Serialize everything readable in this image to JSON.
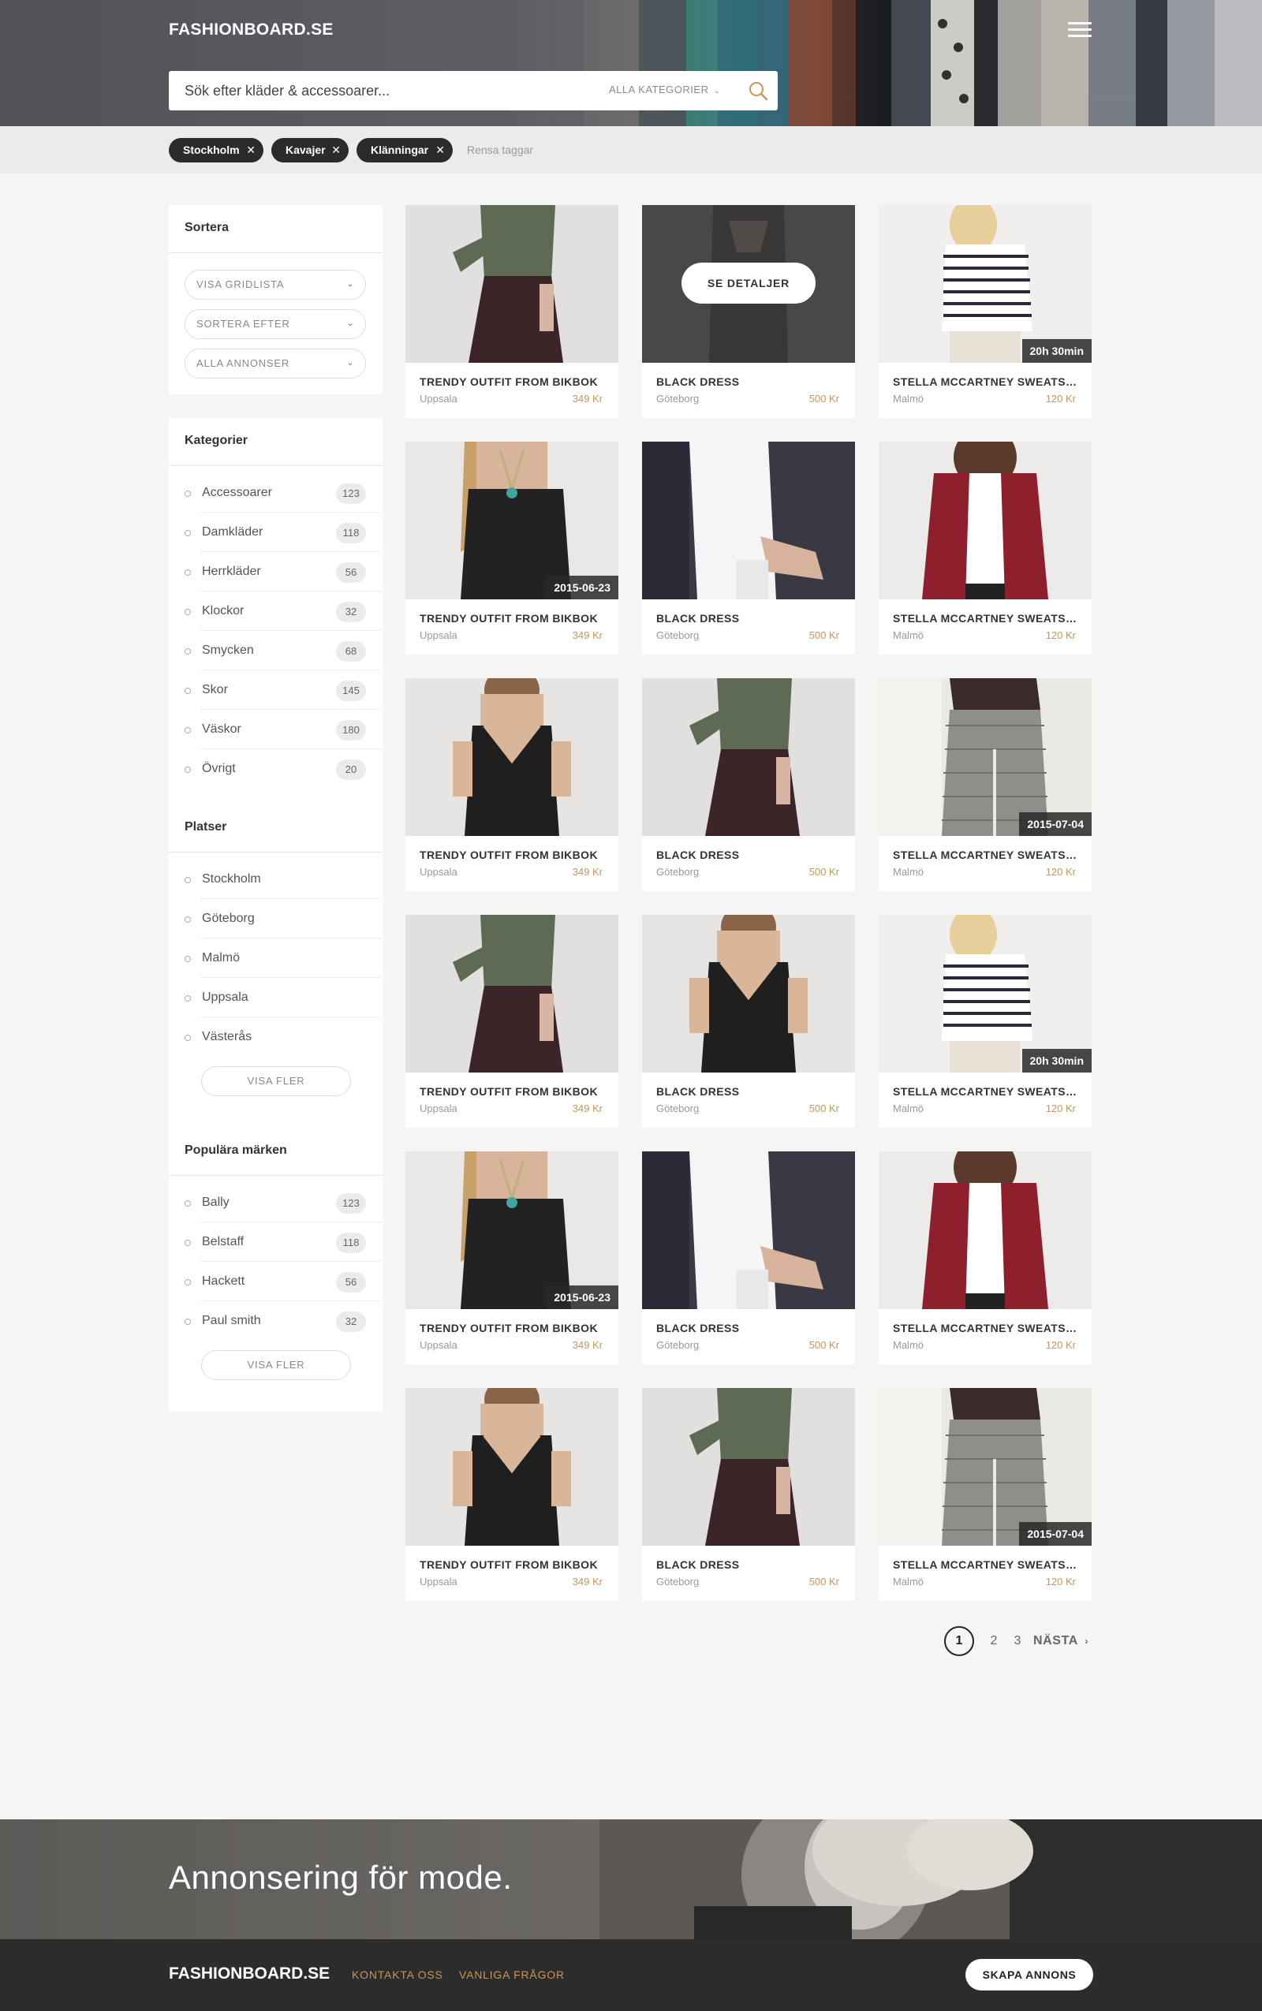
{
  "header": {
    "logo": "FASHIONBOARD.SE",
    "search_placeholder": "Sök efter kläder & accessoarer...",
    "category_select": "ALLA KATEGORIER"
  },
  "tags": [
    "Stockholm",
    "Kavajer",
    "Klänningar"
  ],
  "clear_tags": "Rensa taggar",
  "sort_panel": {
    "title": "Sortera",
    "dropdowns": [
      "VISA GRIDLISTA",
      "SORTERA EFTER",
      "ALLA ANNONSER"
    ]
  },
  "categories": {
    "title": "Kategorier",
    "items": [
      {
        "label": "Accessoarer",
        "count": "123"
      },
      {
        "label": "Damkläder",
        "count": "118"
      },
      {
        "label": "Herrkläder",
        "count": "56"
      },
      {
        "label": "Klockor",
        "count": "32"
      },
      {
        "label": "Smycken",
        "count": "68"
      },
      {
        "label": "Skor",
        "count": "145"
      },
      {
        "label": "Väskor",
        "count": "180"
      },
      {
        "label": "Övrigt",
        "count": "20"
      }
    ]
  },
  "places": {
    "title": "Platser",
    "items": [
      "Stockholm",
      "Göteborg",
      "Malmö",
      "Uppsala",
      "Västerås"
    ],
    "more": "VISA FLER"
  },
  "brands": {
    "title": "Populära märken",
    "items": [
      {
        "label": "Bally",
        "count": "123"
      },
      {
        "label": "Belstaff",
        "count": "118"
      },
      {
        "label": "Hackett",
        "count": "56"
      },
      {
        "label": "Paul smith",
        "count": "32"
      }
    ],
    "more": "VISA FLER"
  },
  "products": [
    {
      "title": "TRENDY OUTFIT FROM BIKBOK",
      "city": "Uppsala",
      "price": "349 Kr",
      "badge": "",
      "hover": "",
      "image": "skirt"
    },
    {
      "title": "BLACK DRESS",
      "city": "Göteborg",
      "price": "500 Kr",
      "badge": "",
      "hover": "SE DETALJER",
      "image": "dress-dark"
    },
    {
      "title": "STELLA MCCARTNEY SWEATSHIRT",
      "city": "Malmö",
      "price": "120 Kr",
      "badge": "20h 30min",
      "hover": "",
      "image": "stripes"
    },
    {
      "title": "TRENDY OUTFIT FROM BIKBOK",
      "city": "Uppsala",
      "price": "349 Kr",
      "badge": "2015-06-23",
      "hover": "",
      "image": "necklace"
    },
    {
      "title": "BLACK DRESS",
      "city": "Göteborg",
      "price": "500 Kr",
      "badge": "",
      "hover": "",
      "image": "white-shirt"
    },
    {
      "title": "STELLA MCCARTNEY SWEATSHIRT",
      "city": "Malmö",
      "price": "120 Kr",
      "badge": "",
      "hover": "",
      "image": "red-blazer"
    },
    {
      "title": "TRENDY OUTFIT FROM BIKBOK",
      "city": "Uppsala",
      "price": "349 Kr",
      "badge": "",
      "hover": "",
      "image": "black-top"
    },
    {
      "title": "BLACK DRESS",
      "city": "Göteborg",
      "price": "500 Kr",
      "badge": "",
      "hover": "",
      "image": "skirt"
    },
    {
      "title": "STELLA MCCARTNEY SWEATSHIRT",
      "city": "Malmö",
      "price": "120 Kr",
      "badge": "2015-07-04",
      "hover": "",
      "image": "checked-pants"
    },
    {
      "title": "TRENDY OUTFIT FROM BIKBOK",
      "city": "Uppsala",
      "price": "349 Kr",
      "badge": "",
      "hover": "",
      "image": "skirt"
    },
    {
      "title": "BLACK DRESS",
      "city": "Göteborg",
      "price": "500 Kr",
      "badge": "",
      "hover": "",
      "image": "black-top"
    },
    {
      "title": "STELLA MCCARTNEY SWEATSHIRT",
      "city": "Malmö",
      "price": "120 Kr",
      "badge": "20h 30min",
      "hover": "",
      "image": "stripes"
    },
    {
      "title": "TRENDY OUTFIT FROM BIKBOK",
      "city": "Uppsala",
      "price": "349 Kr",
      "badge": "2015-06-23",
      "hover": "",
      "image": "necklace"
    },
    {
      "title": "BLACK DRESS",
      "city": "Göteborg",
      "price": "500 Kr",
      "badge": "",
      "hover": "",
      "image": "white-shirt"
    },
    {
      "title": "STELLA MCCARTNEY SWEATSHIRT",
      "city": "Malmö",
      "price": "120 Kr",
      "badge": "",
      "hover": "",
      "image": "red-blazer"
    },
    {
      "title": "TRENDY OUTFIT FROM BIKBOK",
      "city": "Uppsala",
      "price": "349 Kr",
      "badge": "",
      "hover": "",
      "image": "black-top"
    },
    {
      "title": "BLACK DRESS",
      "city": "Göteborg",
      "price": "500 Kr",
      "badge": "",
      "hover": "",
      "image": "skirt"
    },
    {
      "title": "STELLA MCCARTNEY SWEATSHIRT",
      "city": "Malmö",
      "price": "120 Kr",
      "badge": "2015-07-04",
      "hover": "",
      "image": "checked-pants"
    }
  ],
  "pagination": {
    "pages": [
      "1",
      "2",
      "3"
    ],
    "current": "1",
    "next": "NÄSTA"
  },
  "banner": {
    "heading": "Annonsering för mode."
  },
  "footer": {
    "logo": "FASHIONBOARD.SE",
    "links": [
      "KONTAKTA OSS",
      "VANLIGA FRÅGOR"
    ],
    "cta": "SKAPA ANNONS"
  },
  "colors": {
    "accent": "#c8955a",
    "dark": "#2c2c2c",
    "tag": "#2b2b2b"
  }
}
